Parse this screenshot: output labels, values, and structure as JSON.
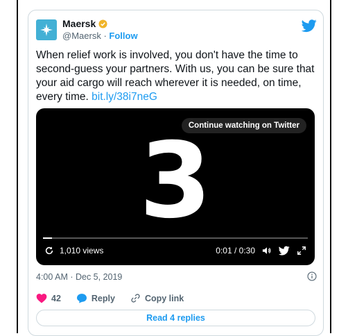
{
  "author": {
    "name": "Maersk",
    "handle": "@Maersk",
    "separator": "·",
    "follow_label": "Follow",
    "verified_badge_color": "#f0b429",
    "logo_color": "#42b0d5"
  },
  "tweet": {
    "text": "When relief work is involved, you don't have the time to second-guess your partners. With us, you can be sure that your aid cargo will reach wherever it is needed, on time, every time.",
    "link": "bit.ly/38i7neG"
  },
  "video": {
    "continue_label": "Continue watching on Twitter",
    "countdown": "3",
    "views": "1,010 views",
    "time": "0:01 / 0:30",
    "progress_fraction": 0.033
  },
  "meta": {
    "timestamp": "4:00 AM · Dec 5, 2019"
  },
  "actions": {
    "like_count": "42",
    "reply_label": "Reply",
    "copy_label": "Copy link",
    "read_replies_label": "Read 4 replies"
  },
  "colors": {
    "twitter_blue": "#1d9bf0",
    "like_red": "#f91880",
    "muted_gray": "#536471"
  }
}
